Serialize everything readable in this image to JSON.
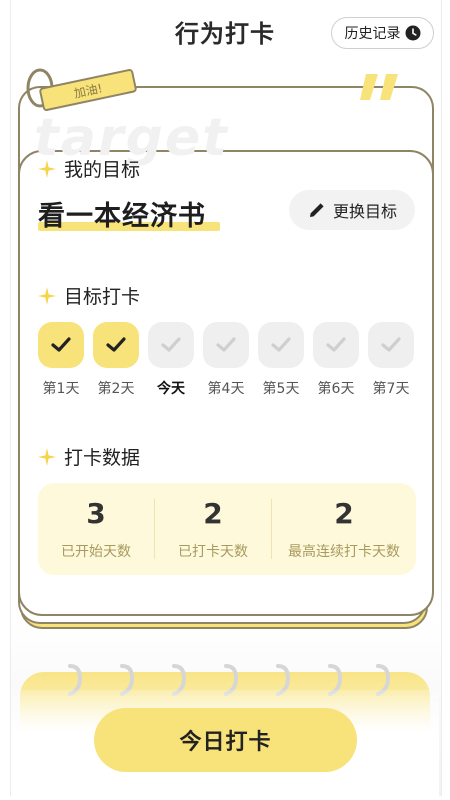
{
  "header": {
    "title": "行为打卡",
    "history_label": "历史记录"
  },
  "card": {
    "tag_label": "加油!",
    "watermark": "target",
    "goal_section": {
      "title": "我的目标",
      "goal": "看一本经济书",
      "change_label": "更换目标"
    },
    "checkin_section": {
      "title": "目标打卡",
      "days": [
        {
          "label": "第1天",
          "done": true
        },
        {
          "label": "第2天",
          "done": true
        },
        {
          "label": "今天",
          "done": false,
          "today": true
        },
        {
          "label": "第4天",
          "done": false
        },
        {
          "label": "第5天",
          "done": false
        },
        {
          "label": "第6天",
          "done": false
        },
        {
          "label": "第7天",
          "done": false
        }
      ]
    },
    "stats_section": {
      "title": "打卡数据",
      "stats": [
        {
          "value": "3",
          "label": "已开始天数"
        },
        {
          "value": "2",
          "label": "已打卡天数"
        },
        {
          "value": "2",
          "label": "最高连续打卡天数"
        }
      ]
    }
  },
  "footer": {
    "checkin_button": "今日打卡"
  },
  "colors": {
    "accent": "#f8e27a",
    "border": "#8f8565",
    "stat_bg": "#fff9dc"
  }
}
